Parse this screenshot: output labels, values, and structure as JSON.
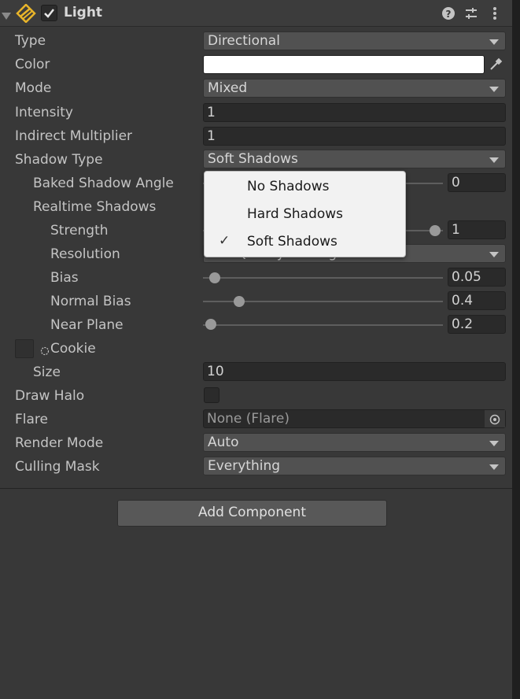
{
  "header": {
    "title": "Light",
    "enabled": true
  },
  "icons": {
    "collapse": "triangle-down-icon",
    "component": "light-component-icon",
    "help": "help-icon",
    "presets": "sliders-icon",
    "menu": "kebab-menu-icon",
    "eyedropper": "eyedropper-icon",
    "object_picker": "target-icon",
    "cookie": "cookie-circle-icon",
    "checkmark": "checkmark-icon"
  },
  "properties": {
    "type": {
      "label": "Type",
      "value": "Directional"
    },
    "color": {
      "label": "Color",
      "value": "#FFFFFF"
    },
    "mode": {
      "label": "Mode",
      "value": "Mixed"
    },
    "intensity": {
      "label": "Intensity",
      "value": "1"
    },
    "indirect_multiplier": {
      "label": "Indirect Multiplier",
      "value": "1"
    },
    "shadow_type": {
      "label": "Shadow Type",
      "value": "Soft Shadows"
    },
    "baked_shadow_angle": {
      "label": "Baked Shadow Angle",
      "value": "0"
    },
    "realtime_shadows": {
      "label": "Realtime Shadows"
    },
    "strength": {
      "label": "Strength",
      "value": "1"
    },
    "resolution": {
      "label": "Resolution",
      "value": "Use Quality Settings"
    },
    "bias": {
      "label": "Bias",
      "value": "0.05"
    },
    "normal_bias": {
      "label": "Normal Bias",
      "value": "0.4"
    },
    "near_plane": {
      "label": "Near Plane",
      "value": "0.2"
    },
    "cookie": {
      "label": "Cookie"
    },
    "size": {
      "label": "Size",
      "value": "10"
    },
    "draw_halo": {
      "label": "Draw Halo",
      "checked": false
    },
    "flare": {
      "label": "Flare",
      "value": "None (Flare)"
    },
    "render_mode": {
      "label": "Render Mode",
      "value": "Auto"
    },
    "culling_mask": {
      "label": "Culling Mask",
      "value": "Everything"
    }
  },
  "shadow_type_popup": {
    "options": [
      {
        "label": "No Shadows",
        "selected": false
      },
      {
        "label": "Hard Shadows",
        "selected": false
      },
      {
        "label": "Soft Shadows",
        "selected": true
      }
    ],
    "check_glyph": "✓"
  },
  "add_component_label": "Add Component"
}
